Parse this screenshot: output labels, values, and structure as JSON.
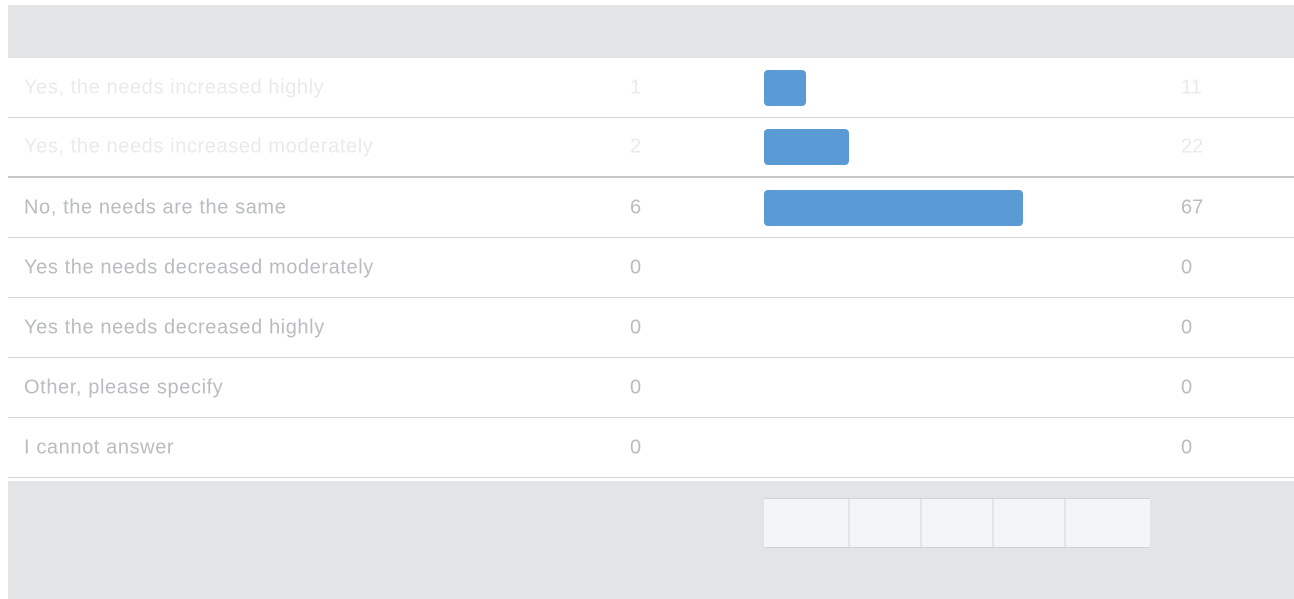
{
  "colors": {
    "bar": "#5b9bd5"
  },
  "rows": [
    {
      "label": "Yes, the needs increased highly",
      "count": "1",
      "percent": "11",
      "share": 0.11,
      "state": "faded"
    },
    {
      "label": "Yes, the needs increased moderately",
      "count": "2",
      "percent": "22",
      "share": 0.22,
      "state": "faded"
    },
    {
      "label": "No, the needs are the same",
      "count": "6",
      "percent": "67",
      "share": 0.67,
      "state": "normal"
    },
    {
      "label": "Yes the needs decreased moderately",
      "count": "0",
      "percent": "0",
      "share": 0,
      "state": "normal"
    },
    {
      "label": "Yes the needs decreased highly",
      "count": "0",
      "percent": "0",
      "share": 0,
      "state": "normal"
    },
    {
      "label": "Other, please specify",
      "count": "0",
      "percent": "0",
      "share": 0,
      "state": "normal"
    },
    {
      "label": "I cannot answer",
      "count": "0",
      "percent": "0",
      "share": 0,
      "state": "normal"
    }
  ],
  "legend_cells": 5
}
